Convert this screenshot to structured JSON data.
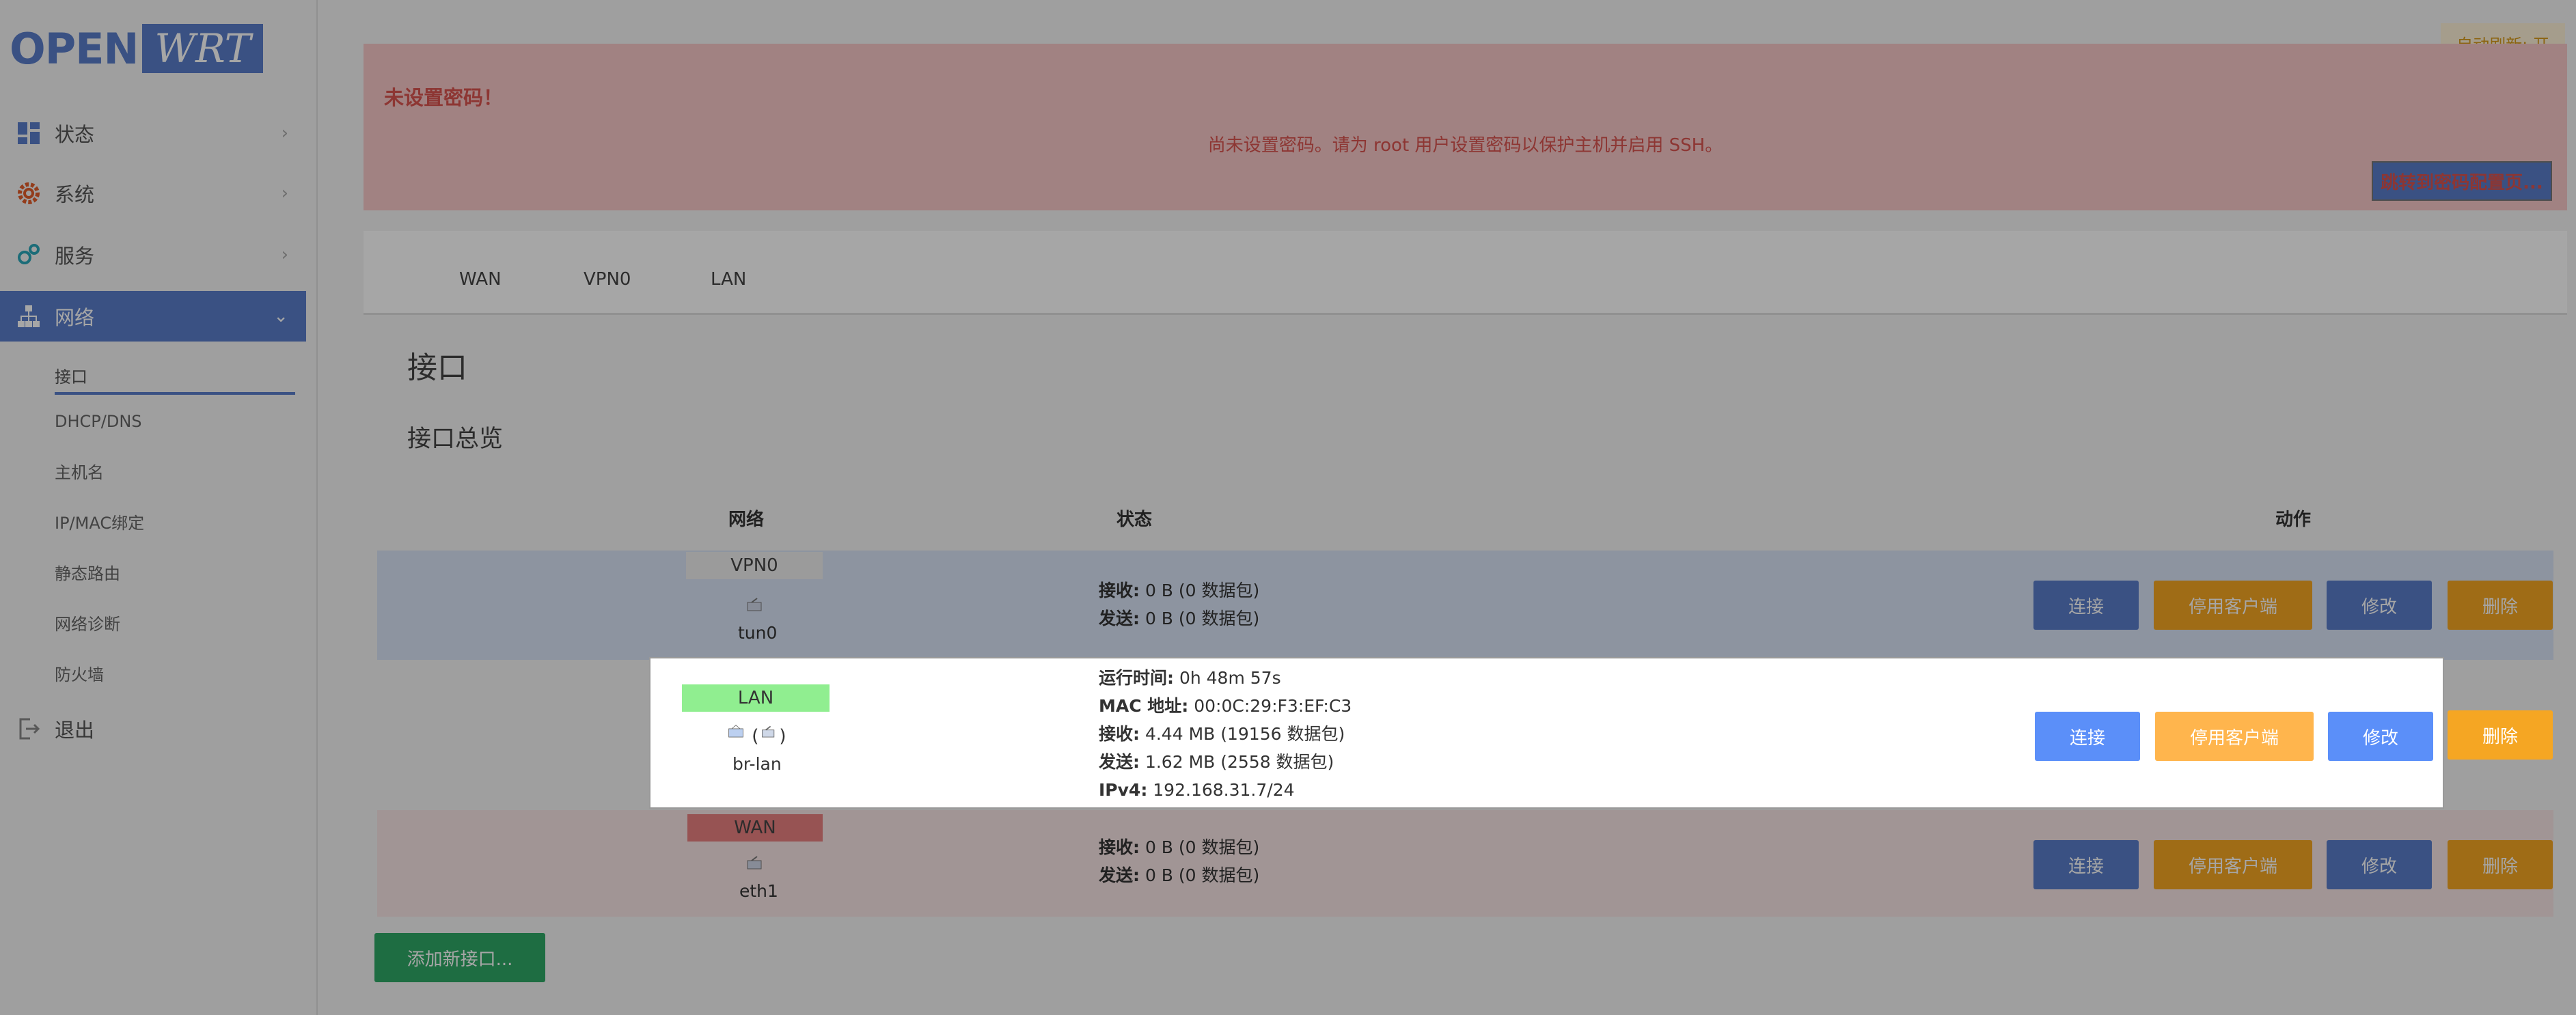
{
  "logo": {
    "part1": "OPEN",
    "part2": "WRT"
  },
  "sidebar": {
    "items": [
      {
        "label": "状态",
        "icon": "dashboard-icon"
      },
      {
        "label": "系统",
        "icon": "gear-icon"
      },
      {
        "label": "服务",
        "icon": "services-icon"
      },
      {
        "label": "网络",
        "icon": "network-icon"
      },
      {
        "label": "退出",
        "icon": "logout-icon"
      }
    ],
    "network_sub": [
      "接口",
      "DHCP/DNS",
      "主机名",
      "IP/MAC绑定",
      "静态路由",
      "网络诊断",
      "防火墙"
    ]
  },
  "header": {
    "auto_refresh": "自动刷新: 开"
  },
  "alert": {
    "title": "未设置密码！",
    "message": "尚未设置密码。请为 root 用户设置密码以保护主机并启用 SSH。",
    "button": "跳转到密码配置页..."
  },
  "tabs": [
    "WAN",
    "VPN0",
    "LAN"
  ],
  "page": {
    "title": "接口",
    "section": "接口总览"
  },
  "table": {
    "headers": {
      "network": "网络",
      "status": "状态",
      "actions": "动作"
    },
    "rows": [
      {
        "name": "VPN0",
        "device": "tun0",
        "rx_label": "接收:",
        "rx": "0 B (0 数据包)",
        "tx_label": "发送:",
        "tx": "0 B (0 数据包)"
      },
      {
        "name": "LAN",
        "device": "br-lan",
        "uptime_label": "运行时间:",
        "uptime": "0h 48m 57s",
        "mac_label": "MAC 地址:",
        "mac": "00:0C:29:F3:EF:C3",
        "rx_label": "接收:",
        "rx": "4.44 MB (19156 数据包)",
        "tx_label": "发送:",
        "tx": "1.62 MB (2558 数据包)",
        "ipv4_label": "IPv4:",
        "ipv4": "192.168.31.7/24"
      },
      {
        "name": "WAN",
        "device": "eth1",
        "rx_label": "接收:",
        "rx": "0 B (0 数据包)",
        "tx_label": "发送:",
        "tx": "0 B (0 数据包)"
      }
    ],
    "buttons": {
      "connect": "连接",
      "stop": "停用客户端",
      "edit": "修改",
      "delete": "删除"
    }
  },
  "add_button": "添加新接口...",
  "colors": {
    "accent": "#5a7dc9",
    "lan": "#90ee90",
    "wan": "#e98080",
    "vpn": "#eeeeee"
  }
}
